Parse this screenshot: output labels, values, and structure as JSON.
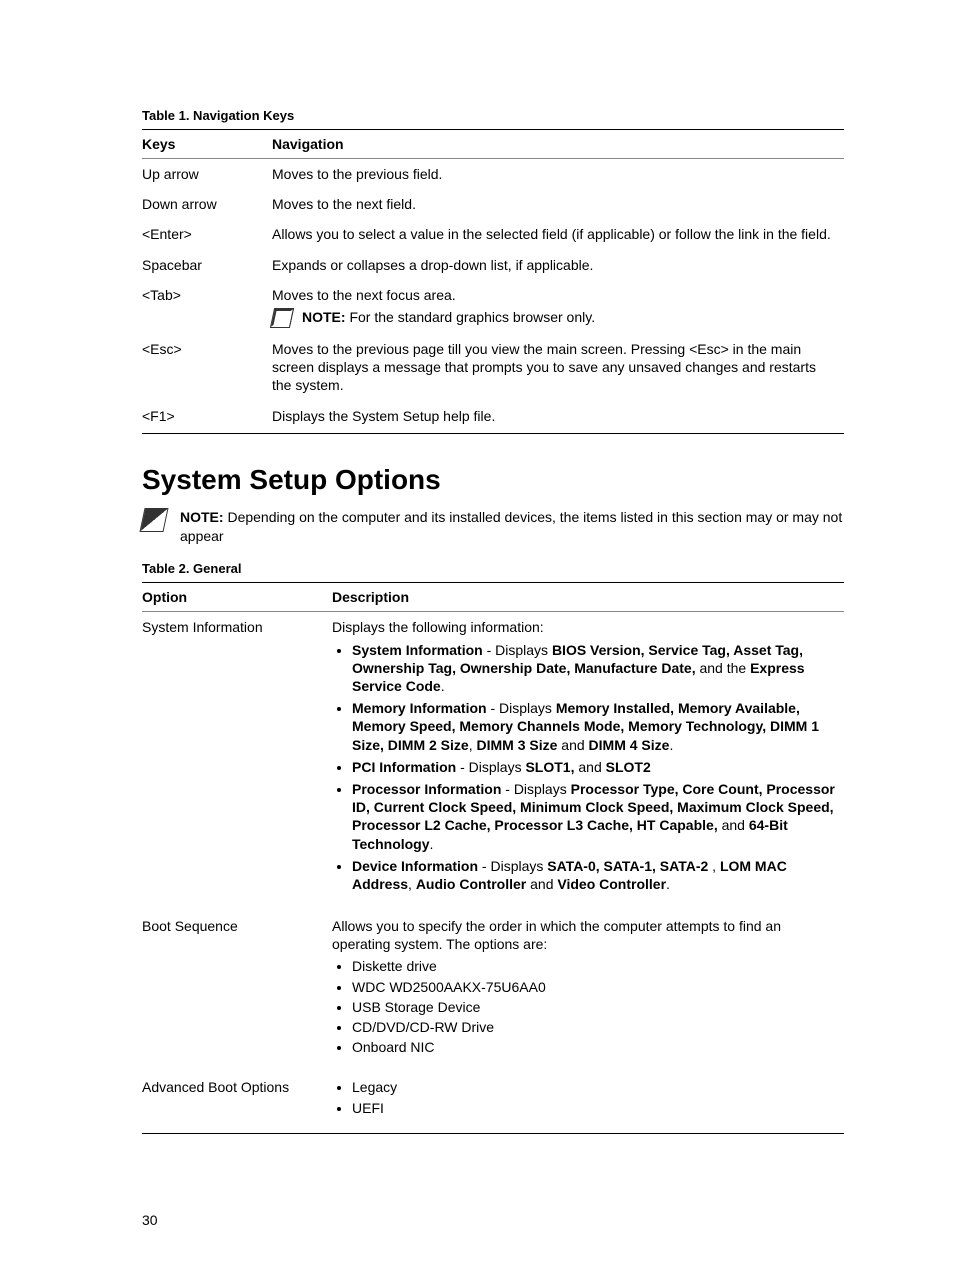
{
  "table1": {
    "caption": "Table 1. Navigation Keys",
    "headers": {
      "col1": "Keys",
      "col2": "Navigation"
    },
    "rows": {
      "up": {
        "key": "Up arrow",
        "nav": "Moves to the previous field."
      },
      "down": {
        "key": "Down arrow",
        "nav": "Moves to the next field."
      },
      "enter": {
        "key": "<Enter>",
        "nav": "Allows you to select a value in the selected field (if applicable) or follow the link in the field."
      },
      "space": {
        "key": "Spacebar",
        "nav": "Expands or collapses a drop-down list, if applicable."
      },
      "tab": {
        "key": "<Tab>",
        "nav": "Moves to the next focus area.",
        "note_label": "NOTE:",
        "note_text": " For the standard graphics browser only."
      },
      "esc": {
        "key": "<Esc>",
        "nav": "Moves to the previous page till you view the main screen. Pressing <Esc> in the main screen displays a message that prompts you to save any unsaved changes and restarts the system."
      },
      "f1": {
        "key": "<F1>",
        "nav": "Displays the System Setup help file."
      }
    }
  },
  "section": {
    "title": "System Setup Options",
    "note_label": "NOTE:",
    "note_text": " Depending on the computer and its installed devices, the items listed in this section may or may not appear"
  },
  "table2": {
    "caption": "Table 2. General",
    "headers": {
      "col1": "Option",
      "col2": "Description"
    },
    "sysinfo": {
      "option": "System Information",
      "intro": "Displays the following information:",
      "b1": {
        "lead_b": "System Information",
        "mid": " - Displays ",
        "bold1": "BIOS Version, Service Tag, Asset Tag, Ownership Tag, Ownership Date, Manufacture Date,",
        "mid2": " and the ",
        "bold2": "Express Service Code",
        "end": "."
      },
      "b2": {
        "lead_b": "Memory Information",
        "mid": " - Displays ",
        "bold1": "Memory Installed, Memory Available, Memory Speed, Memory Channels Mode, Memory Technology, DIMM 1 Size, DIMM 2 Size",
        "mid2": ", ",
        "bold2": "DIMM 3 Size",
        "mid3": " and ",
        "bold3": "DIMM 4 Size",
        "end": "."
      },
      "b3": {
        "lead_b": "PCI Information",
        "mid": " - Displays ",
        "bold1": "SLOT1,",
        "mid2": " and ",
        "bold2": "SLOT2"
      },
      "b4": {
        "lead_b": "Processor Information",
        "mid": " - Displays ",
        "bold1": "Processor Type, Core Count, Processor ID, Current Clock Speed, Minimum Clock Speed, Maximum Clock Speed, Processor L2 Cache, Processor L3 Cache, HT Capable,",
        "mid2": " and ",
        "bold2": "64-Bit Technology",
        "end": "."
      },
      "b5": {
        "lead_b": "Device Information",
        "mid": " - Displays ",
        "bold1": "SATA-0, SATA-1, SATA-2",
        "mid2": " , ",
        "bold2": "LOM MAC Address",
        "mid3": ", ",
        "bold3": "Audio Controller",
        "mid4": " and ",
        "bold4": "Video Controller",
        "end": "."
      }
    },
    "boot": {
      "option": "Boot Sequence",
      "intro": "Allows you to specify the order in which the computer attempts to find an operating system. The options are:",
      "items": {
        "i1": "Diskette drive",
        "i2": "WDC WD2500AAKX-75U6AA0",
        "i3": "USB Storage Device",
        "i4": "CD/DVD/CD-RW Drive",
        "i5": "Onboard NIC"
      }
    },
    "adv": {
      "option": "Advanced Boot Options",
      "items": {
        "i1": "Legacy",
        "i2": "UEFI"
      }
    }
  },
  "page_number": "30"
}
